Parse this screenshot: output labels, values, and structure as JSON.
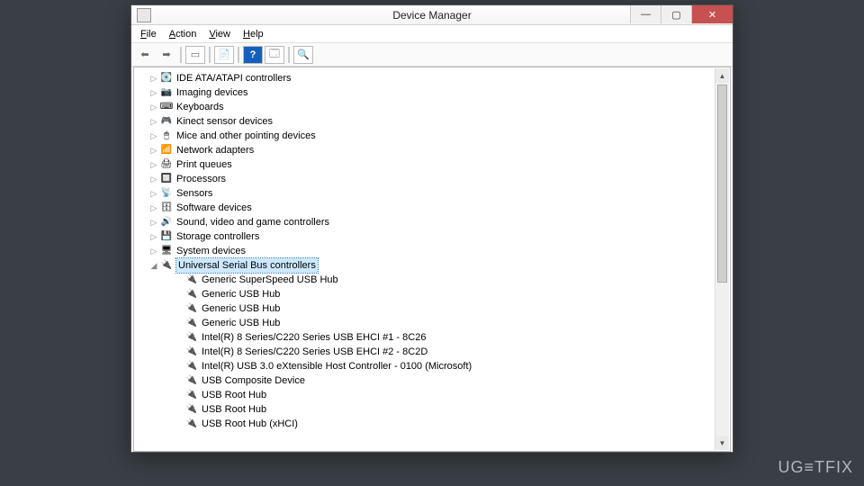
{
  "window": {
    "title": "Device Manager"
  },
  "menu": {
    "file": "File",
    "action": "Action",
    "view": "View",
    "help": "Help"
  },
  "tree": {
    "collapsed": [
      "IDE ATA/ATAPI controllers",
      "Imaging devices",
      "Keyboards",
      "Kinect sensor devices",
      "Mice and other pointing devices",
      "Network adapters",
      "Print queues",
      "Processors",
      "Sensors",
      "Software devices",
      "Sound, video and game controllers",
      "Storage controllers",
      "System devices"
    ],
    "expanded": {
      "label": "Universal Serial Bus controllers",
      "children": [
        "Generic SuperSpeed USB Hub",
        "Generic USB Hub",
        "Generic USB Hub",
        "Generic USB Hub",
        "Intel(R) 8 Series/C220 Series USB EHCI #1 - 8C26",
        "Intel(R) 8 Series/C220 Series USB EHCI #2 - 8C2D",
        "Intel(R) USB 3.0 eXtensible Host Controller - 0100 (Microsoft)",
        "USB Composite Device",
        "USB Root Hub",
        "USB Root Hub",
        "USB Root Hub (xHCI)"
      ]
    }
  },
  "watermark": "UG≡TFIX"
}
